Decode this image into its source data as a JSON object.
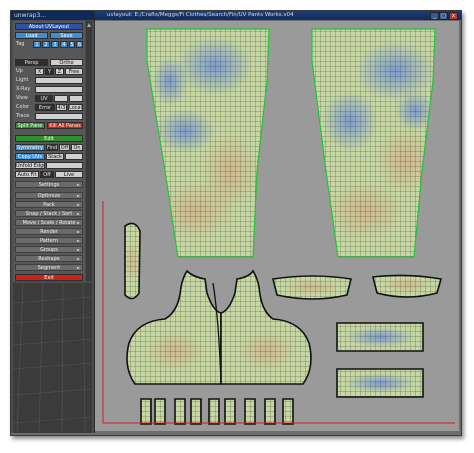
{
  "left_window": {
    "title": "unwrap3..."
  },
  "toolbar": {
    "about": "About UVLayout",
    "load": "Load",
    "save": "Save",
    "tag_label": "Tag",
    "tag_numbers": [
      "1",
      "2",
      "3",
      "4",
      "5",
      "6"
    ],
    "persp": "Persp",
    "ortho": "Ortho",
    "up_label": "Up",
    "up_values": [
      "X",
      "Y",
      "Z"
    ],
    "light_label": "Light",
    "xray_label": "X-Ray",
    "view_label": "View",
    "view_value": "UV",
    "color_label": "Color",
    "color_value": "Error",
    "color_ratio": "4/3",
    "color_local": "Local",
    "trace_label": "Trace",
    "split_pane": "Split Pane",
    "kill_all_panes": "Kill All Panes",
    "edit_label": "Edit",
    "symmetry_label": "Symmetry",
    "symmetry_find": "Find",
    "symmetry_off": "Off",
    "symmetry_on": "On",
    "copy_uvs": "Copy UVs",
    "copy_stack": "Stack",
    "unfold_edges": "Unfold Edges",
    "autofit": "Auto Fit",
    "autofit_off": "Off",
    "autofit_live": "Live",
    "settings": "Settings",
    "sections": [
      "Optimize",
      "Pack",
      "Snap / Stack / Sort",
      "Move / Scale / Rotate",
      "Render",
      "Pattern",
      "Groups",
      "Reshape",
      "Segment"
    ],
    "exit": "Exit"
  },
  "main_window": {
    "title": "uvlayout: E:/Crafts/Meggs/Fi Clothes/Search/Fin/UV Pants Works.v04"
  },
  "colors": {
    "seam_green": "#22c43a",
    "border_black": "#111111",
    "mesh_grid": "#2b3b2b",
    "shell_fill": "#c7d7a3",
    "stretch_blue": "#6f8fd8",
    "stretch_tan": "#d4b38a",
    "viewport_bg": "#9a9a9a",
    "uv_axis_red": "#d81c1c"
  }
}
